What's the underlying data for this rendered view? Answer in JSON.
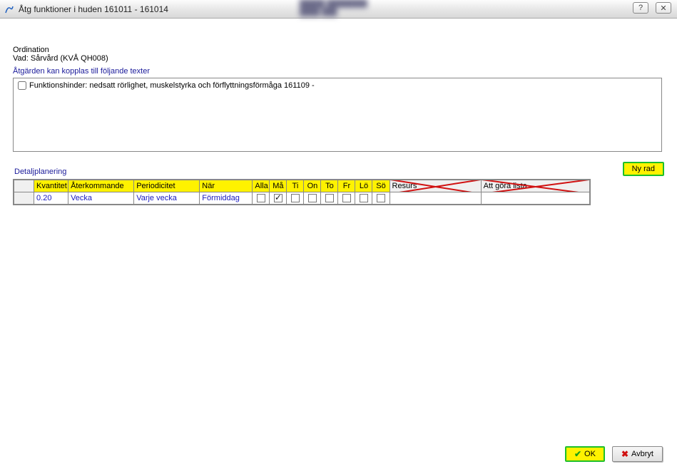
{
  "titlebar": {
    "text": "Åtg funktioner i huden 161011  -  161014"
  },
  "ordination": {
    "label": "Ordination",
    "vad": "Vad: Sårvård (KVÅ QH008)"
  },
  "section_texter": {
    "label": "Åtgärden kan kopplas till följande texter",
    "items": [
      {
        "text": "Funktionshinder: nedsatt rörlighet, muskelstyrka och förflyttningsförmåga 161109 -",
        "checked": false
      }
    ]
  },
  "detaljplanering": {
    "label": "Detaljplanering",
    "ny_rad_label": "Ny rad",
    "columns": {
      "kvantitet": "Kvantitet",
      "aterkommande": "Återkommande",
      "periodicitet": "Periodicitet",
      "nar": "När",
      "alla": "Alla",
      "ma": "Må",
      "ti": "Ti",
      "on_": "On",
      "to": "To",
      "fr": "Fr",
      "lo": "Lö",
      "so": "Sö",
      "resurs": "Resurs",
      "att_gora": "Att göra lista"
    },
    "rows": [
      {
        "kvantitet": "0.20",
        "aterkommande": "Vecka",
        "periodicitet": "Varje vecka",
        "nar": "Förmiddag",
        "days": {
          "alla": false,
          "ma": true,
          "ti": false,
          "on_": false,
          "to": false,
          "fr": false,
          "lo": false,
          "so": false
        },
        "resurs": "",
        "att_gora": ""
      }
    ]
  },
  "footer": {
    "ok": "OK",
    "avbryt": "Avbryt"
  }
}
